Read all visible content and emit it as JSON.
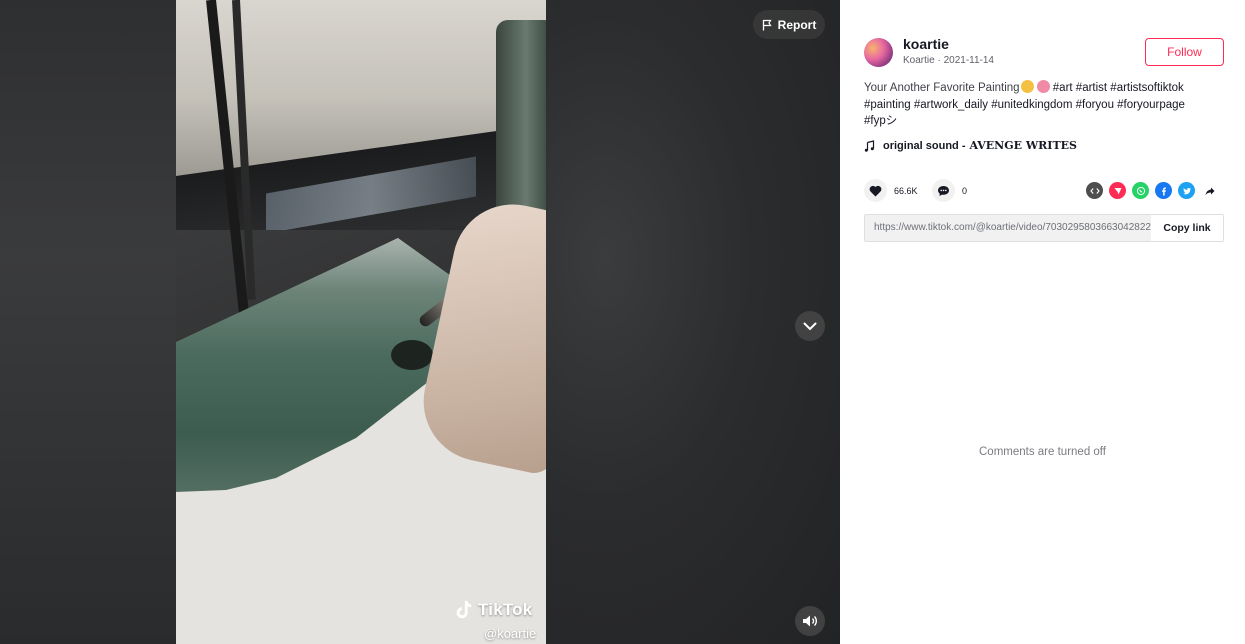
{
  "video": {
    "report_label": "Report",
    "watermark_brand": "TikTok",
    "watermark_user": "@koartie"
  },
  "post": {
    "username": "koartie",
    "display_name": "Koartie",
    "date": "2021-11-14",
    "subline": "Koartie · 2021-11-14",
    "follow_label": "Follow",
    "caption": "Your Another Favorite Painting",
    "hashtags_line1": "#art #artist #artistsoftiktok",
    "hashtags_line2": "#painting #artwork_daily #unitedkingdom #foryou #foryourpage",
    "hashtags_line3": "#fypシ",
    "music_prefix": "original sound -",
    "music_artist": "AVENGE WRITES",
    "likes": "66.6K",
    "comments": "0",
    "link_url": "https://www.tiktok.com/@koartie/video/7030295803663042822",
    "copy_label": "Copy link",
    "comments_off_text": "Comments are turned off"
  },
  "colors": {
    "accent": "#fe2c55",
    "text": "#161823",
    "embed": "#4e4e4e",
    "tiktok_share": "#fe2c55",
    "whatsapp": "#25d366",
    "facebook": "#1877f2",
    "twitter": "#1da1f2"
  },
  "icons": {
    "report": "flag-icon",
    "down": "chevron-down-icon",
    "sound": "speaker-icon",
    "like": "heart-icon",
    "comment": "comment-icon",
    "music": "music-note-icon",
    "share": [
      "embed-icon",
      "tiktok-share-icon",
      "whatsapp-icon",
      "facebook-icon",
      "twitter-icon",
      "share-arrow-icon"
    ]
  }
}
